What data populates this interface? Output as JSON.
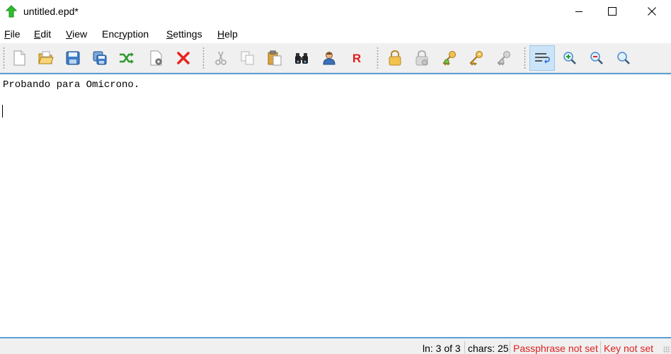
{
  "window": {
    "title": "untitled.epd*",
    "controls": {
      "minimize": "minimize",
      "maximize": "maximize",
      "close": "close"
    }
  },
  "menu": {
    "file": {
      "accel": "F",
      "rest": "ile"
    },
    "edit": {
      "accel": "E",
      "rest": "dit"
    },
    "view": {
      "accel": "V",
      "rest": "iew"
    },
    "encryption": {
      "pre": "Enc",
      "accel": "r",
      "rest": "yption"
    },
    "settings": {
      "accel": "S",
      "rest": "ettings"
    },
    "help": {
      "accel": "H",
      "rest": "elp"
    }
  },
  "toolbar": {
    "buttons": [
      {
        "icon": "new-file-icon"
      },
      {
        "icon": "open-folder-icon"
      },
      {
        "icon": "save-icon"
      },
      {
        "icon": "save-all-icon"
      },
      {
        "icon": "shuffle-icon"
      },
      {
        "icon": "file-settings-icon"
      },
      {
        "icon": "delete-x-icon"
      },
      {
        "icon": "cut-icon"
      },
      {
        "icon": "copy-icon"
      },
      {
        "icon": "paste-icon"
      },
      {
        "icon": "binoculars-icon"
      },
      {
        "icon": "user-icon"
      },
      {
        "icon": "r-letter-icon",
        "glyph": "R"
      },
      {
        "icon": "lock-icon"
      },
      {
        "icon": "lock-disabled-icon"
      },
      {
        "icon": "key-pair-icon"
      },
      {
        "icon": "key-icon"
      },
      {
        "icon": "key-disabled-icon"
      },
      {
        "icon": "word-wrap-icon",
        "active": true
      },
      {
        "icon": "zoom-in-icon"
      },
      {
        "icon": "zoom-out-icon"
      },
      {
        "icon": "zoom-reset-icon"
      }
    ]
  },
  "editor": {
    "lines": [
      "Probando para Omicrono.",
      "",
      ""
    ]
  },
  "status": {
    "line_info": "ln: 3 of 3",
    "chars": "chars: 25",
    "passphrase": "Passphrase not set",
    "key": "Key not set"
  },
  "colors": {
    "accent": "#5a9fd4",
    "status_warning": "#e02020",
    "toolbar_bg": "#f0f0f0"
  }
}
